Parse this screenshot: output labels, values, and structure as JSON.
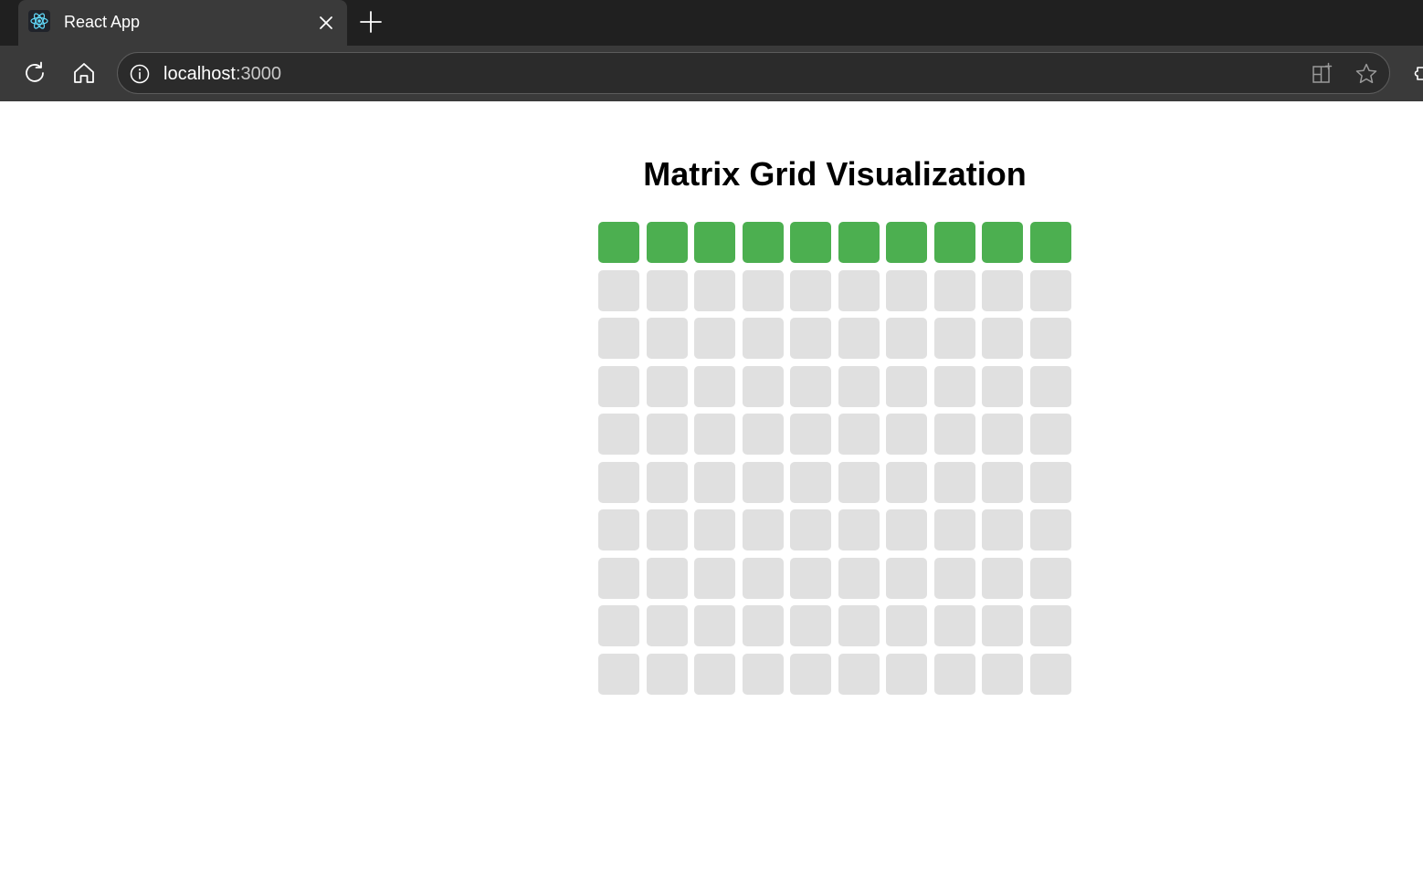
{
  "browser": {
    "tab": {
      "title": "React App",
      "favicon": "react-logo-icon",
      "close_icon": "close-icon"
    },
    "new_tab_icon": "plus-icon",
    "toolbar": {
      "reload_icon": "reload-icon",
      "home_icon": "home-icon"
    },
    "address_bar": {
      "site_info_icon": "info-icon",
      "host": "localhost",
      "port": ":3000",
      "split_screen_icon": "split-screen-icon",
      "favorite_icon": "star-icon"
    }
  },
  "page": {
    "title": "Matrix Grid Visualization",
    "matrix": {
      "rows": 10,
      "columns": 10,
      "active_color": "#4caf50",
      "inactive_color": "#e0e0e0",
      "cells": [
        [
          1,
          1,
          1,
          1,
          1,
          1,
          1,
          1,
          1,
          1
        ],
        [
          0,
          0,
          0,
          0,
          0,
          0,
          0,
          0,
          0,
          0
        ],
        [
          0,
          0,
          0,
          0,
          0,
          0,
          0,
          0,
          0,
          0
        ],
        [
          0,
          0,
          0,
          0,
          0,
          0,
          0,
          0,
          0,
          0
        ],
        [
          0,
          0,
          0,
          0,
          0,
          0,
          0,
          0,
          0,
          0
        ],
        [
          0,
          0,
          0,
          0,
          0,
          0,
          0,
          0,
          0,
          0
        ],
        [
          0,
          0,
          0,
          0,
          0,
          0,
          0,
          0,
          0,
          0
        ],
        [
          0,
          0,
          0,
          0,
          0,
          0,
          0,
          0,
          0,
          0
        ],
        [
          0,
          0,
          0,
          0,
          0,
          0,
          0,
          0,
          0,
          0
        ],
        [
          0,
          0,
          0,
          0,
          0,
          0,
          0,
          0,
          0,
          0
        ]
      ]
    }
  }
}
